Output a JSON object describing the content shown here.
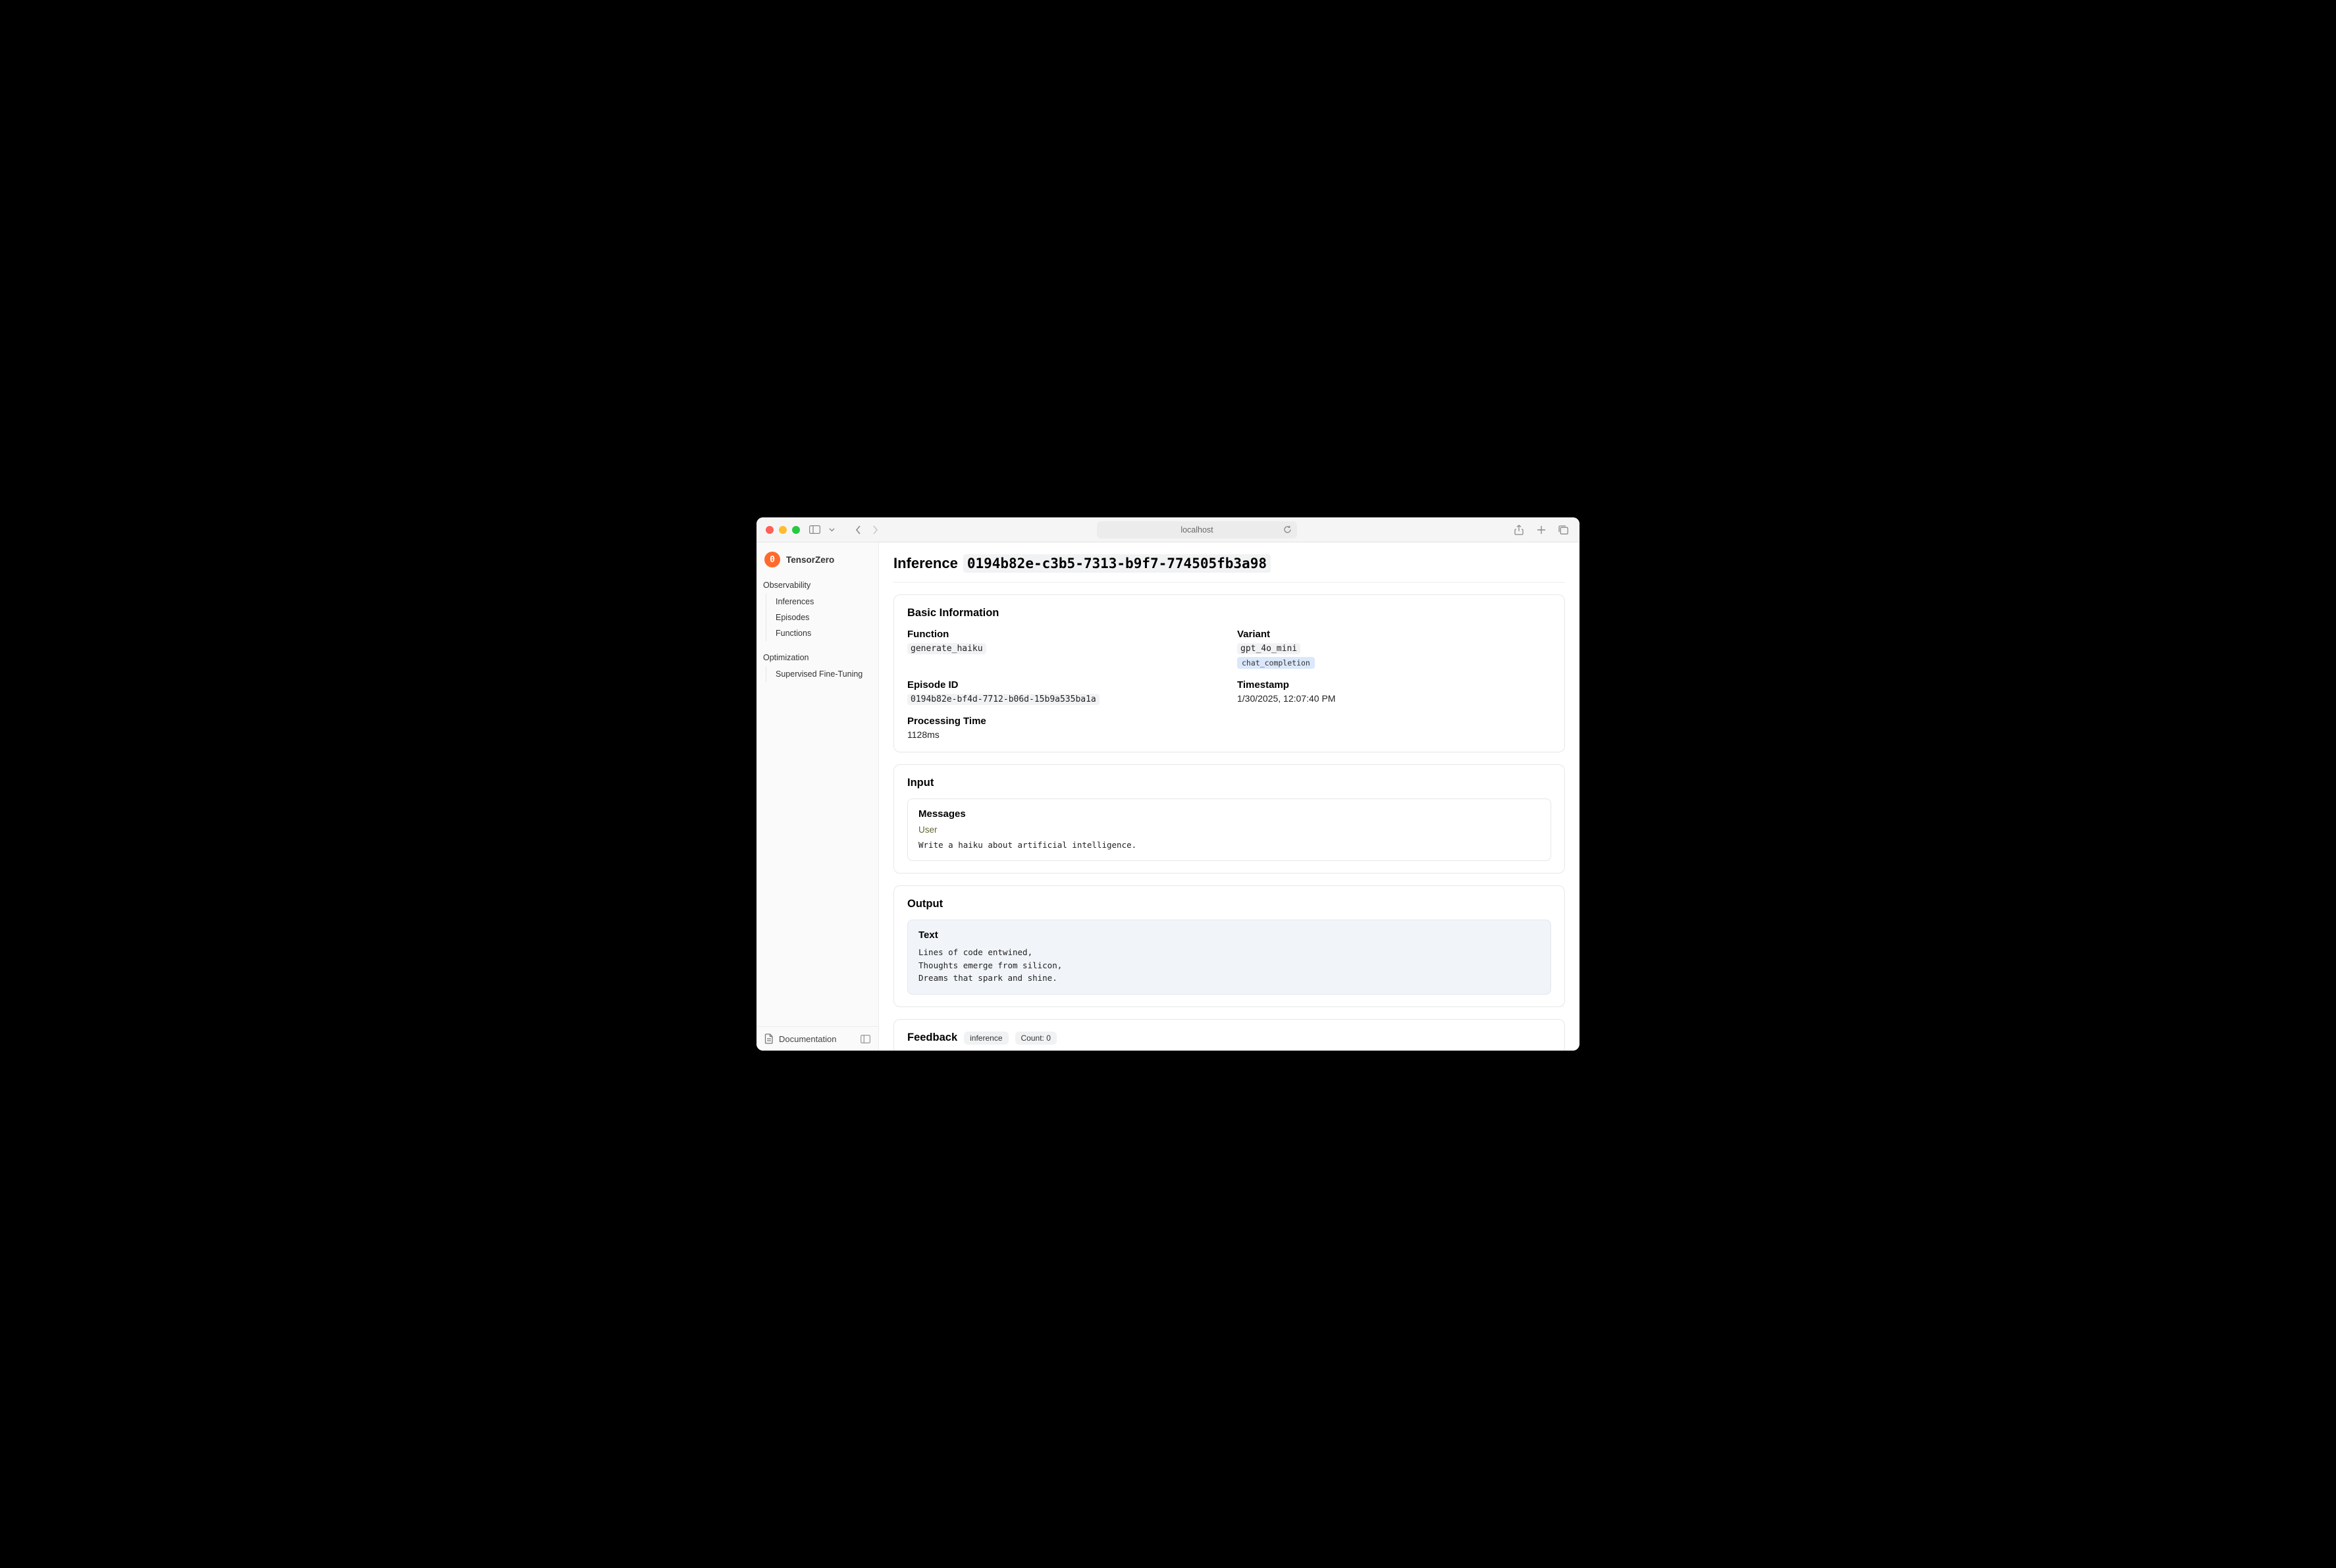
{
  "browser": {
    "address": "localhost"
  },
  "brand": {
    "name": "TensorZero",
    "logo_letter": "0"
  },
  "sidebar": {
    "sections": [
      {
        "label": "Observability",
        "items": [
          {
            "label": "Inferences"
          },
          {
            "label": "Episodes"
          },
          {
            "label": "Functions"
          }
        ]
      },
      {
        "label": "Optimization",
        "items": [
          {
            "label": "Supervised Fine-Tuning"
          }
        ]
      }
    ],
    "footer": {
      "label": "Documentation"
    }
  },
  "page": {
    "title_prefix": "Inference",
    "inference_id": "0194b82e-c3b5-7313-b9f7-774505fb3a98"
  },
  "basic_info": {
    "heading": "Basic Information",
    "function_label": "Function",
    "function_value": "generate_haiku",
    "variant_label": "Variant",
    "variant_value": "gpt_4o_mini",
    "variant_type": "chat_completion",
    "episode_label": "Episode ID",
    "episode_value": "0194b82e-bf4d-7712-b06d-15b9a535ba1a",
    "timestamp_label": "Timestamp",
    "timestamp_value": "1/30/2025, 12:07:40 PM",
    "processing_label": "Processing Time",
    "processing_value": "1128ms"
  },
  "input": {
    "heading": "Input",
    "messages_heading": "Messages",
    "role": "User",
    "content": "Write a haiku about artificial intelligence."
  },
  "output": {
    "heading": "Output",
    "text_heading": "Text",
    "content": "Lines of code entwined,\nThoughts emerge from silicon,\nDreams that spark and shine."
  },
  "feedback": {
    "heading": "Feedback",
    "scope": "inference",
    "count_label": "Count: 0"
  }
}
